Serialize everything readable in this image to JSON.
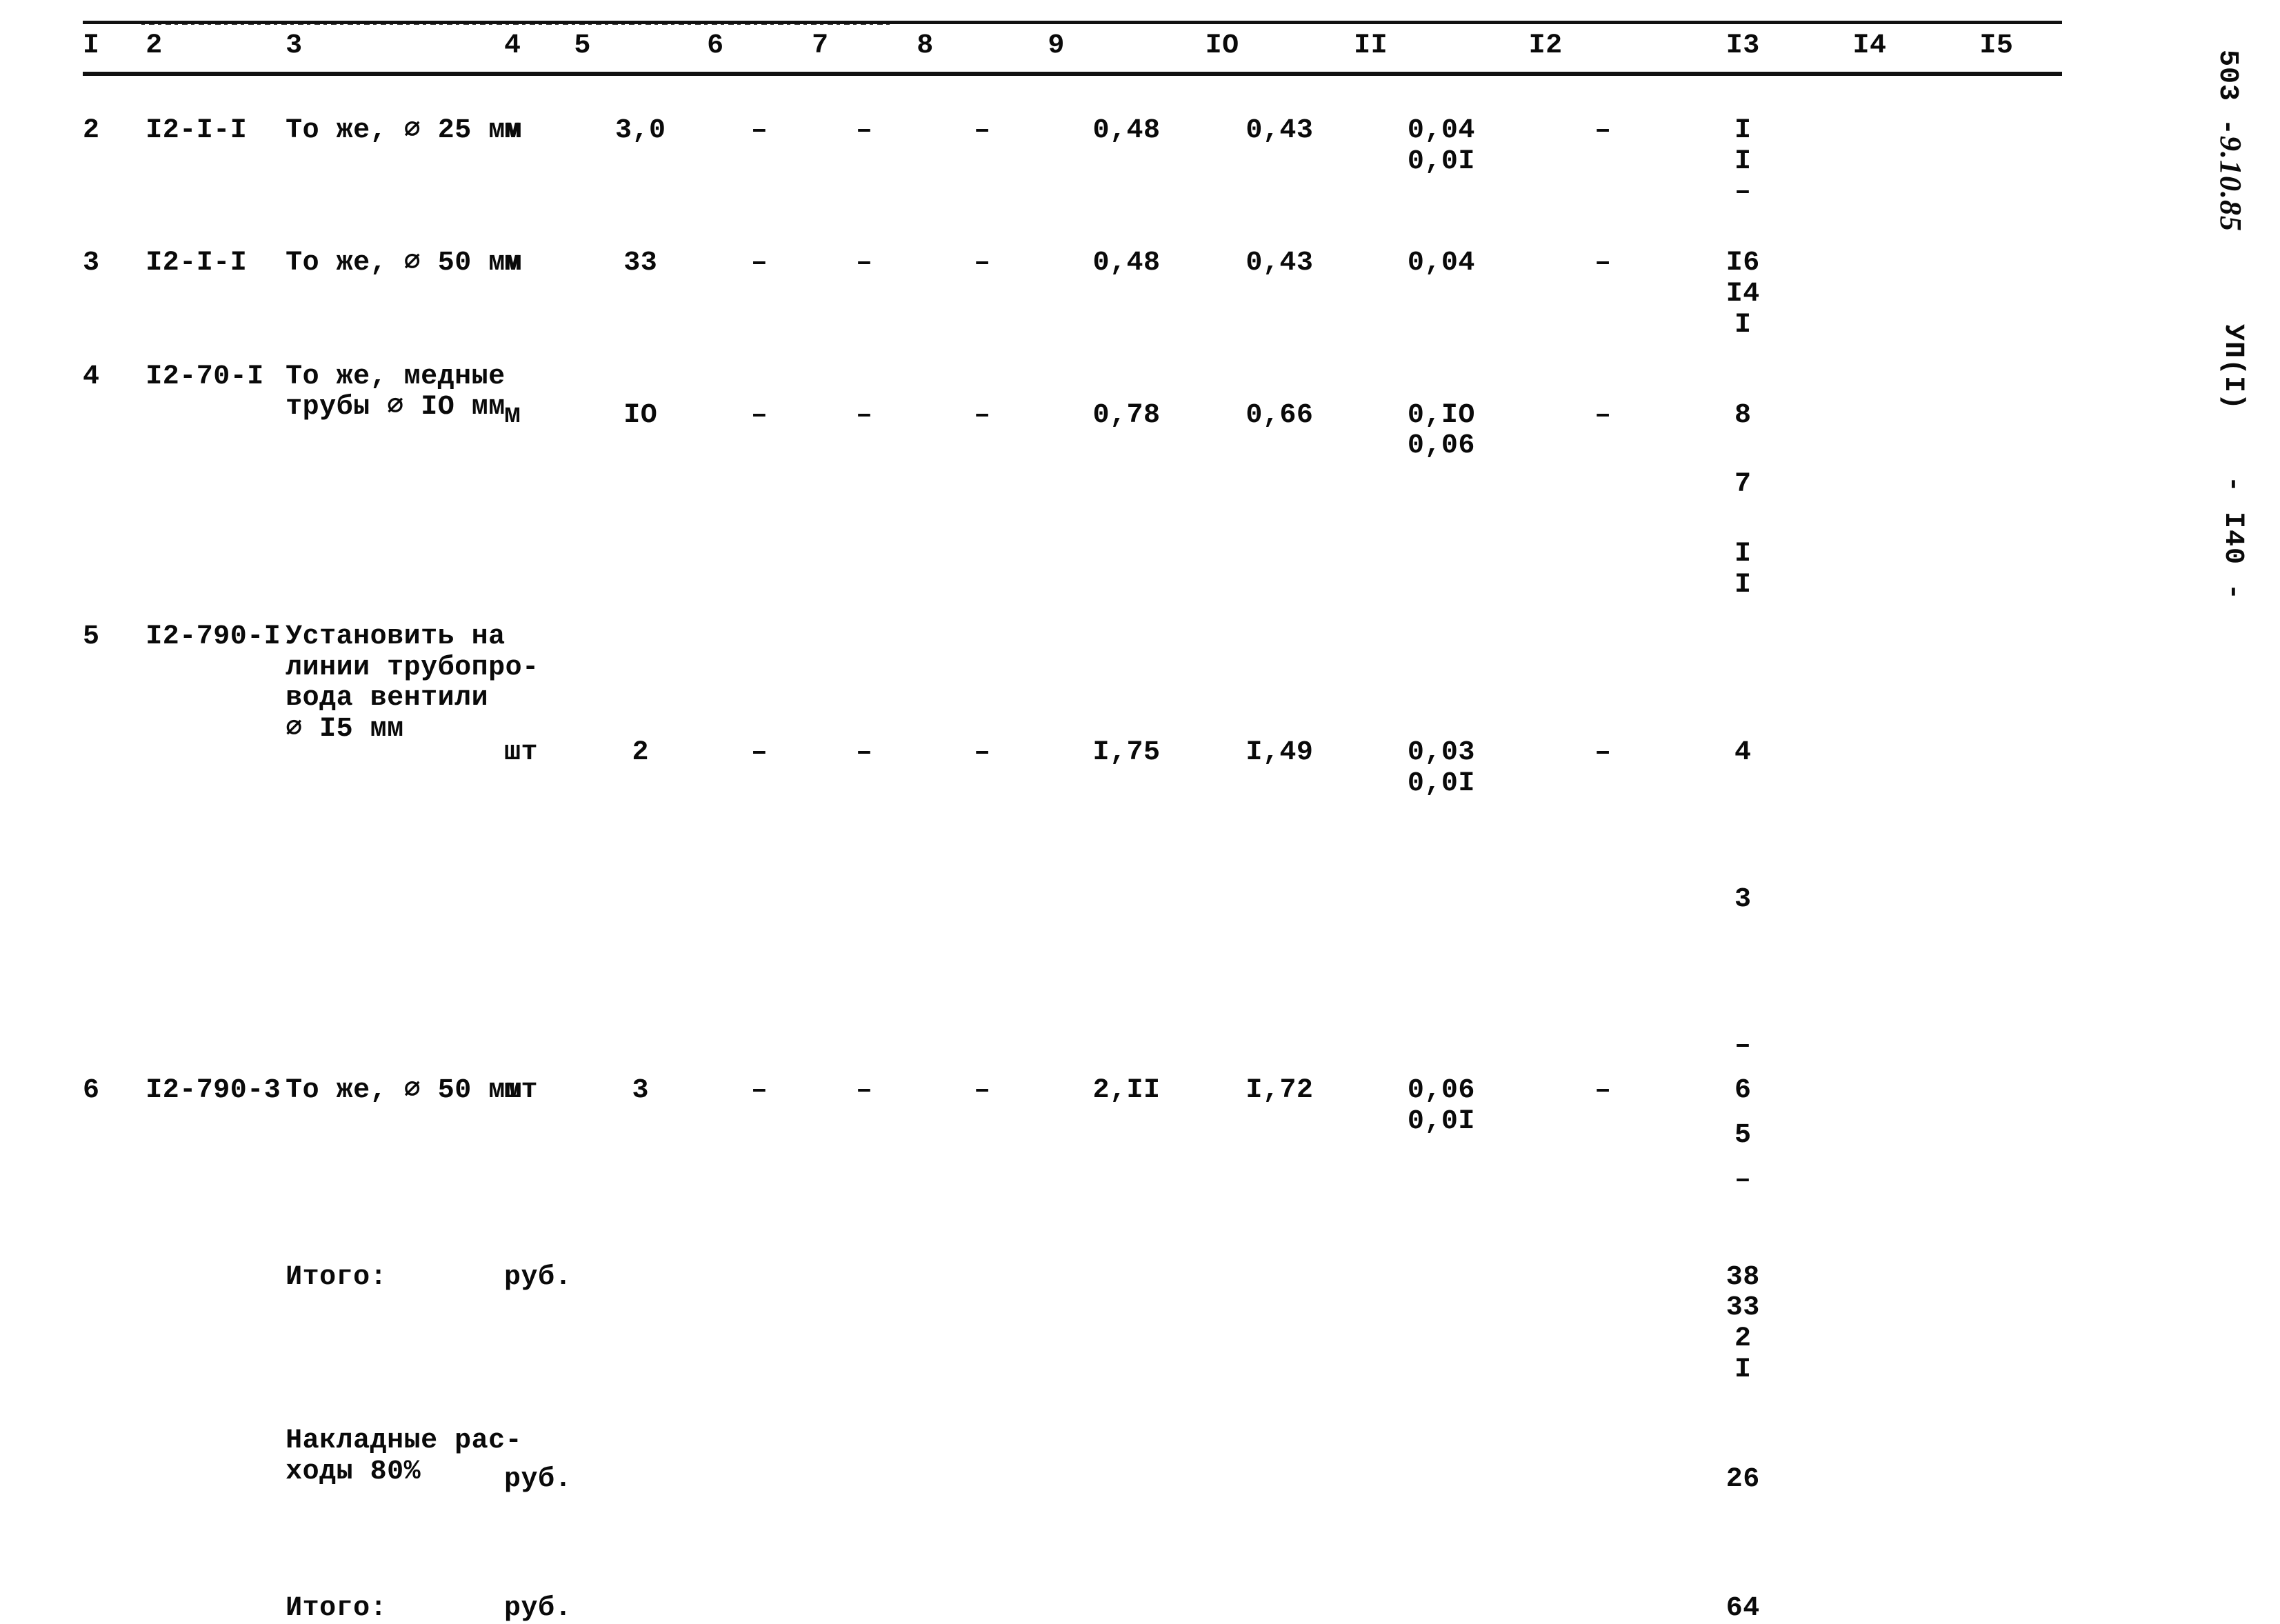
{
  "document": {
    "type": "estimate-table",
    "ink_color": "#0a0a0a",
    "paper_color": "#ffffff"
  },
  "side_marks": {
    "drawing_code": "503 -",
    "drawing_code_hand": "9.10.85",
    "sheet_mark": "УП(I)",
    "page_mark": "- I40 -"
  },
  "table": {
    "headers": [
      "I",
      "2",
      "3",
      "4",
      "5",
      "6",
      "7",
      "8",
      "9",
      "IO",
      "II",
      "I2",
      "I3",
      "I4",
      "I5"
    ],
    "rows": [
      {
        "num": "2",
        "code": "I2-I-I",
        "desc": [
          "То же, ⌀ 25 мм"
        ],
        "unit": "м",
        "c5": "3,0",
        "c6": "–",
        "c7": "–",
        "c8": "–",
        "c9": "0,48",
        "c10": "0,43",
        "c11": [
          "0,04",
          "0,0I"
        ],
        "c12": "–",
        "c13": [
          "I"
        ],
        "c14": [
          "I"
        ],
        "c15": [
          "–"
        ]
      },
      {
        "num": "3",
        "code": "I2-I-I",
        "desc": [
          "То же, ⌀ 50 мм"
        ],
        "unit": "м",
        "c5": "33",
        "c6": "–",
        "c7": "–",
        "c8": "–",
        "c9": "0,48",
        "c10": "0,43",
        "c11": [
          "0,04"
        ],
        "c12": "–",
        "c13": [
          "I6"
        ],
        "c14": [
          "I4"
        ],
        "c15": [
          "I"
        ]
      },
      {
        "num": "4",
        "code": "I2-70-I",
        "desc": [
          "То же, медные",
          "трубы ⌀ IO мм"
        ],
        "unit": "м",
        "c5": "IO",
        "c6": "–",
        "c7": "–",
        "c8": "–",
        "c9": "0,78",
        "c10": "0,66",
        "c11": [
          "0,IO",
          "0,06"
        ],
        "c12": "–",
        "c13": [
          "8"
        ],
        "c14": [
          "7"
        ],
        "c15": [
          "I",
          "I"
        ]
      },
      {
        "num": "5",
        "code": "I2-790-I",
        "desc": [
          "Установить на",
          "линии трубопро-",
          "вода вентили",
          "⌀ I5 мм"
        ],
        "unit": "шт",
        "c5": "2",
        "c6": "–",
        "c7": "–",
        "c8": "–",
        "c9": "I,75",
        "c10": "I,49",
        "c11": [
          "0,03",
          "0,0I"
        ],
        "c12": "–",
        "c13": [
          "4"
        ],
        "c14": [
          "3"
        ],
        "c15": [
          "–"
        ]
      },
      {
        "num": "6",
        "code": "I2-790-3",
        "desc": [
          "То же, ⌀ 50 мм"
        ],
        "unit": "шт",
        "c5": "3",
        "c6": "–",
        "c7": "–",
        "c8": "–",
        "c9": "2,II",
        "c10": "I,72",
        "c11": [
          "0,06",
          "0,0I"
        ],
        "c12": "–",
        "c13": [
          "6"
        ],
        "c14": [
          "5"
        ],
        "c15": [
          "–"
        ]
      }
    ],
    "summary_rows": [
      {
        "label": [
          "Итого:"
        ],
        "unit": "руб.",
        "c13": [
          "38"
        ],
        "c14": [
          "33"
        ],
        "c15": [
          "2",
          "I"
        ]
      },
      {
        "label": [
          "Накладные рас-",
          "ходы 80%"
        ],
        "unit": "руб.",
        "c13": [
          "26"
        ],
        "c14": [
          ""
        ],
        "c15": [
          ""
        ]
      },
      {
        "label": [
          "Итого:"
        ],
        "unit": "руб.",
        "c13": [
          "64"
        ],
        "c14": [
          ""
        ],
        "c15": [
          ""
        ]
      }
    ]
  }
}
